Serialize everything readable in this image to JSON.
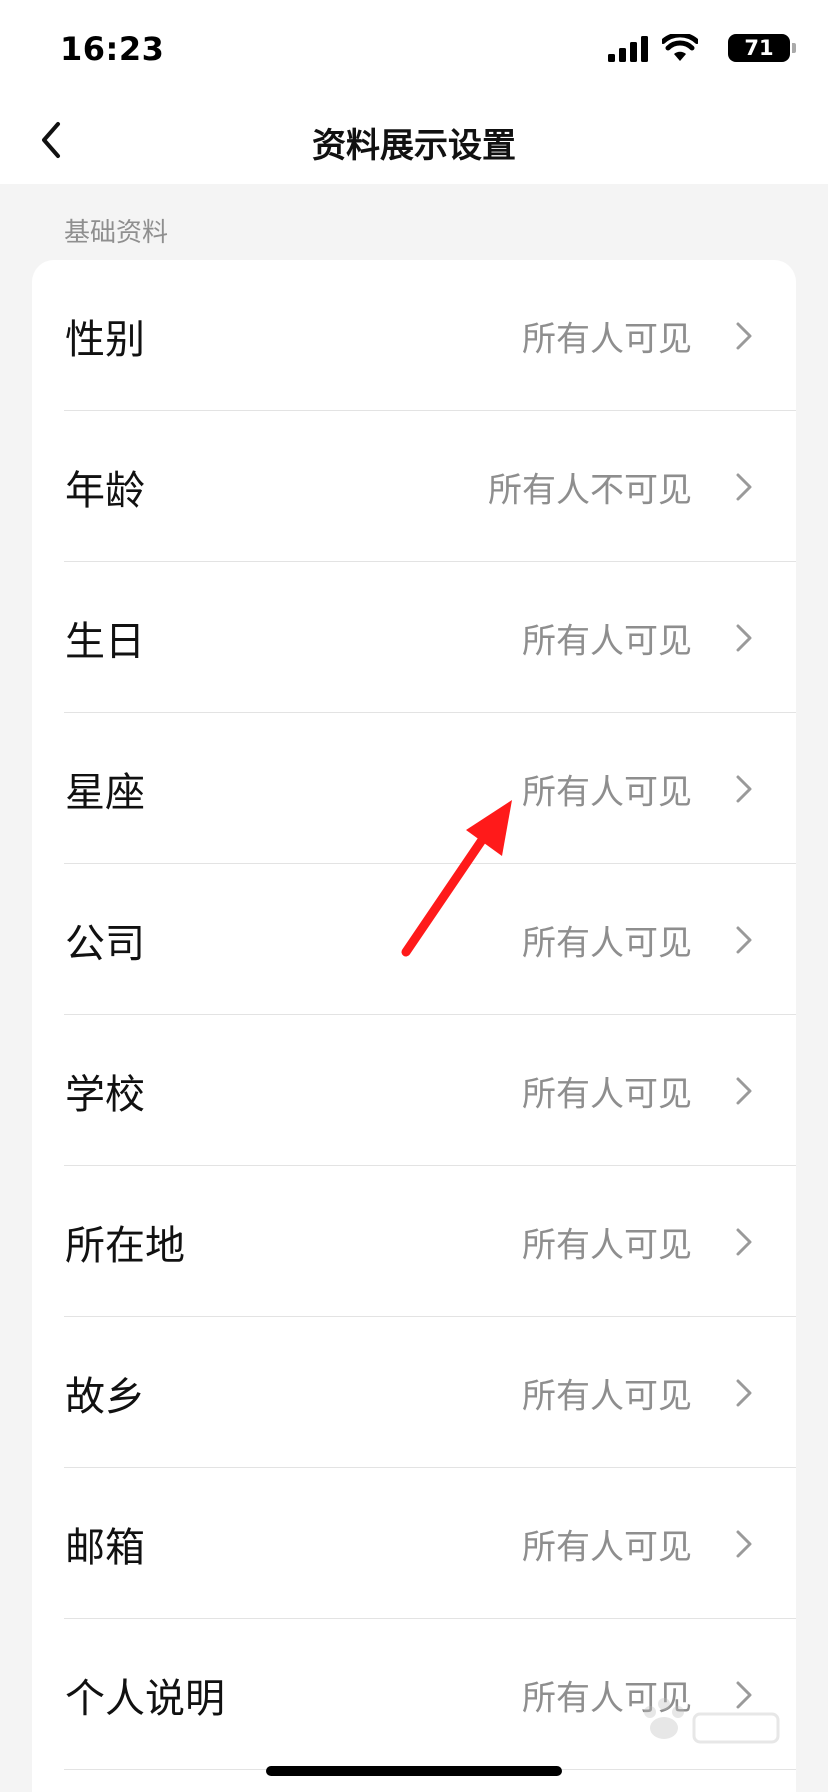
{
  "status_bar": {
    "time": "16:23",
    "battery": "71",
    "icons": [
      "signal-icon",
      "wifi-icon",
      "battery-icon"
    ]
  },
  "nav": {
    "title": "资料展示设置",
    "back_icon": "chevron-left-icon"
  },
  "section": {
    "title": "基础资料"
  },
  "items": [
    {
      "label": "性别",
      "value": "所有人可见"
    },
    {
      "label": "年龄",
      "value": "所有人不可见"
    },
    {
      "label": "生日",
      "value": "所有人可见"
    },
    {
      "label": "星座",
      "value": "所有人可见"
    },
    {
      "label": "公司",
      "value": "所有人可见"
    },
    {
      "label": "学校",
      "value": "所有人可见"
    },
    {
      "label": "所在地",
      "value": "所有人可见"
    },
    {
      "label": "故乡",
      "value": "所有人可见"
    },
    {
      "label": "邮箱",
      "value": "所有人可见"
    },
    {
      "label": "个人说明",
      "value": "所有人可见"
    }
  ],
  "colors": {
    "annotation_arrow": "#ff1a1a",
    "secondary_text": "#8e8e8e",
    "background": "#f4f4f4"
  }
}
